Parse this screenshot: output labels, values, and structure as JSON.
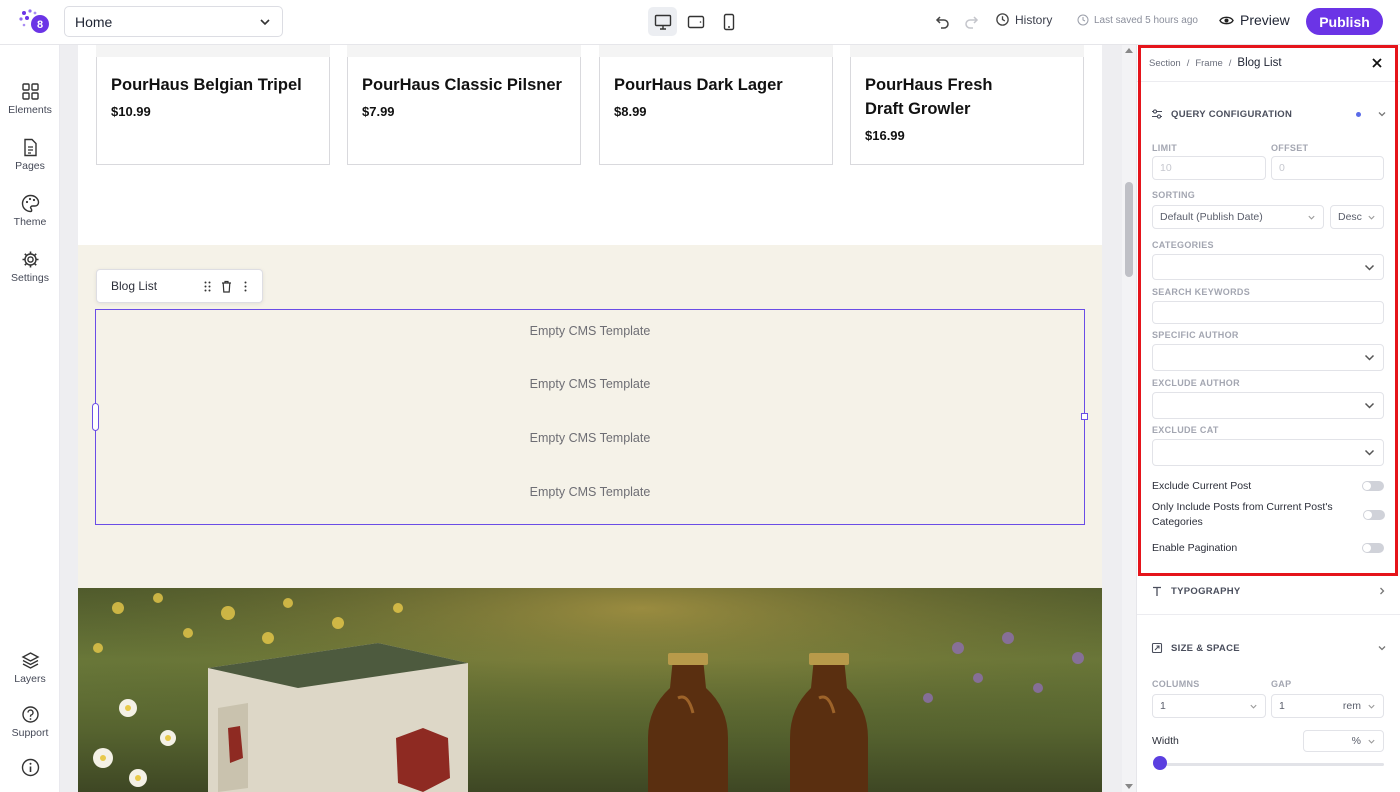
{
  "topbar": {
    "page_select": "Home",
    "history_label": "History",
    "last_saved": "Last saved 5 hours ago",
    "preview_label": "Preview",
    "publish_label": "Publish"
  },
  "sidebar": {
    "items": [
      {
        "label": "Elements",
        "icon": "grid-icon"
      },
      {
        "label": "Pages",
        "icon": "page-icon"
      },
      {
        "label": "Theme",
        "icon": "palette-icon"
      },
      {
        "label": "Settings",
        "icon": "gear-icon"
      },
      {
        "label": "Layers",
        "icon": "layers-icon"
      },
      {
        "label": "Support",
        "icon": "help-icon"
      }
    ]
  },
  "canvas": {
    "products": [
      {
        "name": "PourHaus Belgian Tripel",
        "price": "$10.99"
      },
      {
        "name": "PourHaus Classic Pilsner",
        "price": "$7.99"
      },
      {
        "name": "PourHaus Dark Lager",
        "price": "$8.99"
      },
      {
        "name": "PourHaus Fresh Draft Growler",
        "price": "$16.99"
      }
    ],
    "element_toolbar_label": "Blog List",
    "cms_items": [
      "Empty CMS Template",
      "Empty CMS Template",
      "Empty CMS Template",
      "Empty CMS Template"
    ]
  },
  "panel": {
    "breadcrumb": [
      "Section",
      "Frame",
      "Blog List"
    ],
    "query": {
      "title": "QUERY CONFIGURATION",
      "limit_label": "LIMIT",
      "limit_placeholder": "10",
      "offset_label": "OFFSET",
      "offset_placeholder": "0",
      "sorting_label": "SORTING",
      "sorting_value": "Default (Publish Date)",
      "sort_order": "Desc",
      "categories_label": "CATEGORIES",
      "search_label": "SEARCH KEYWORDS",
      "author_label": "SPECIFIC AUTHOR",
      "exclude_author_label": "EXCLUDE AUTHOR",
      "exclude_cat_label": "EXCLUDE CAT",
      "exclude_current_post": "Exclude Current Post",
      "only_include_current_cats": "Only Include Posts from Current Post's Categories",
      "enable_pagination": "Enable Pagination"
    },
    "typography_title": "TYPOGRAPHY",
    "size_space": {
      "title": "SIZE & SPACE",
      "columns_label": "COLUMNS",
      "columns_value": "1",
      "gap_label": "GAP",
      "gap_value": "1",
      "gap_unit": "rem",
      "width_label": "Width",
      "width_unit": "%"
    }
  },
  "colors": {
    "accent": "#6b34e6",
    "highlight": "#e5141b",
    "selection": "#6a4de6"
  }
}
